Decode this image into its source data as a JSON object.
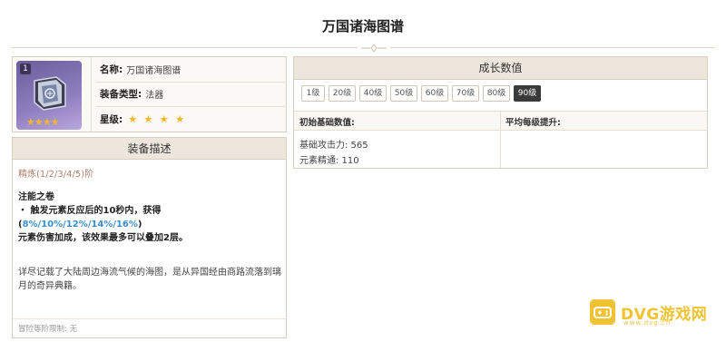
{
  "page": {
    "title": "万国诸海图谱"
  },
  "info": {
    "badge": "1",
    "name_key": "名称:",
    "name_val": "万国诸海图谱",
    "type_key": "装备类型:",
    "type_val": "法器",
    "star_key": "星级:",
    "star_count": 4,
    "stars": "★ ★ ★ ★",
    "thumb_stars": "★★★★"
  },
  "description": {
    "header": "装备描述",
    "refine": "精炼(1/2/3/4/5)阶",
    "skill_name": "注能之卷",
    "skill_line1_prefix": "・ 触发元素反应后的10秒内，获得(",
    "skill_values": "8%/10%/12%/14%/16%",
    "skill_line1_suffix": ")",
    "skill_line2": "元素伤害加成，该效果最多可以叠加2层。",
    "lore": "详尽记载了大陆周边海流气候的海图，是从异国经由商路流落到璃月的奇异典籍。",
    "limit": "冒险等阶限制: 无"
  },
  "growth": {
    "header": "成长数值",
    "levels": [
      "1级",
      "20级",
      "40级",
      "50级",
      "60级",
      "70级",
      "80级",
      "90级"
    ],
    "active_level": "90级",
    "col1_header": "初始基础数值:",
    "col2_header": "平均每级提升:",
    "stat1": "基础攻击力: 565",
    "stat2": "元素精通: 110"
  },
  "watermark": {
    "text": "DVG游戏网",
    "sub": "www.dvg.cn"
  },
  "colors": {
    "accent_blue": "#3a8fd0",
    "star_gold": "#f3b62b",
    "header_bg": "#ece6dc",
    "watermark": "#f1c332"
  }
}
